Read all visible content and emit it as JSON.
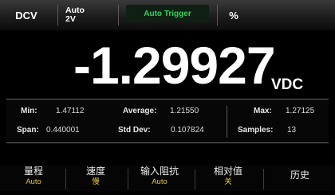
{
  "topbar": {
    "function": "DCV",
    "range_line1": "Auto",
    "range_line2": "2V",
    "trigger": "Auto Trigger",
    "percent_symbol": "%"
  },
  "display": {
    "reading": "-1.29927",
    "unit": "VDC"
  },
  "stats": {
    "min_label": "Min:",
    "min_value": "1.47112",
    "average_label": "Average:",
    "average_value": "1.21550",
    "max_label": "Max:",
    "max_value": "1.27125",
    "span_label": "Span:",
    "span_value": "0.440001",
    "stddev_label": "Std Dev:",
    "stddev_value": "0.107824",
    "samples_label": "Samples:",
    "samples_value": "13"
  },
  "softkeys": [
    {
      "label": "量程",
      "sub": "Auto"
    },
    {
      "label": "速度",
      "sub": "慢"
    },
    {
      "label": "输入阻抗",
      "sub": "Auto"
    },
    {
      "label": "相对值",
      "sub": "关"
    },
    {
      "label": "历史",
      "sub": ""
    }
  ],
  "colors": {
    "trigger_text": "#2fd35a",
    "softkey_value": "#e8c52a"
  }
}
